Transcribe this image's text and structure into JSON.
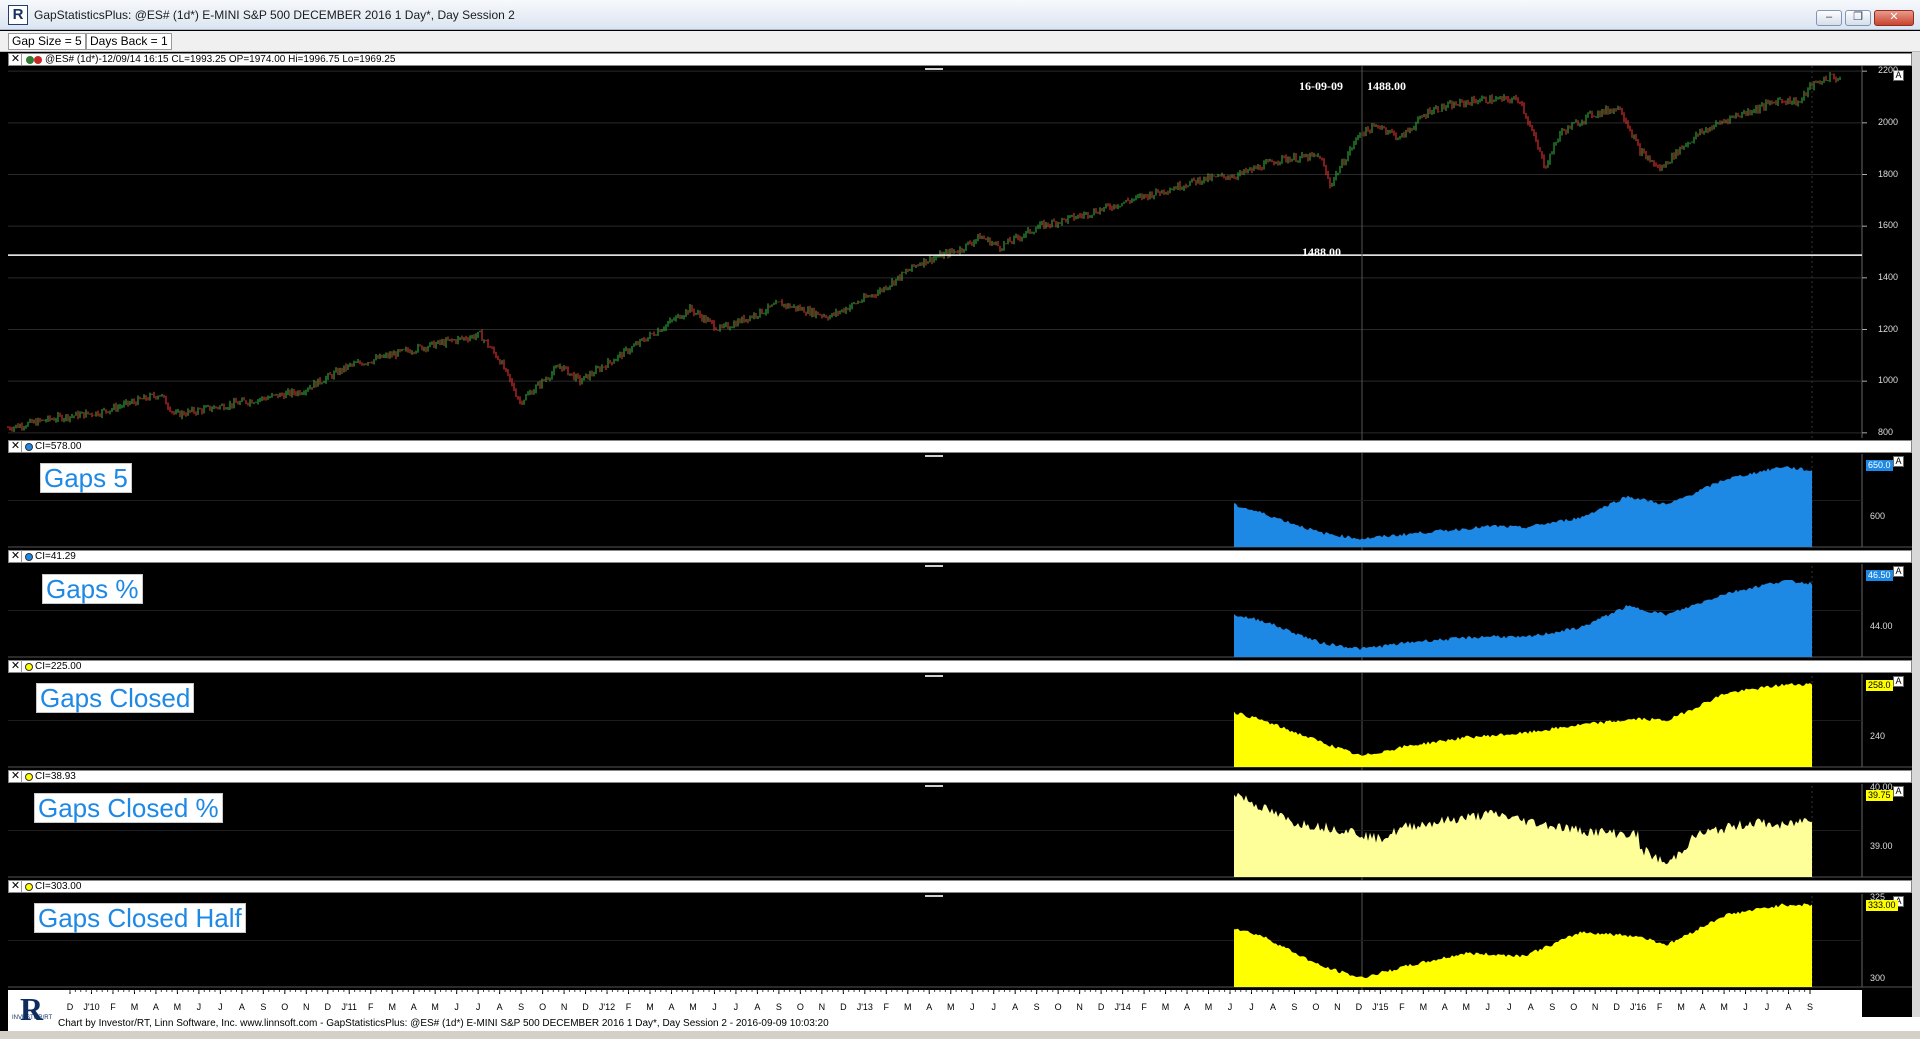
{
  "window": {
    "title": "GapStatisticsPlus: @ES# (1d*) E-MINI S&P 500 DECEMBER 2016 1 Day*, Day Session 2",
    "buttons": {
      "minimize": "–",
      "restore": "❐",
      "close": "✕"
    }
  },
  "params": [
    {
      "label": "Gap Size = 5"
    },
    {
      "label": "Days Back = 1"
    }
  ],
  "price_panel": {
    "header": "@ES# (1d*)-12/09/14 16:15 CL=1993.25 OP=1974.00 Hi=1996.75 Lo=1969.25",
    "cursor_date": "16-09-09",
    "cursor_value": "1488.00",
    "hline_value": "1488.00",
    "y_ticks": [
      "2200",
      "2000",
      "1800",
      "1600",
      "1400",
      "1200",
      "1000",
      "800"
    ],
    "a_label": "A"
  },
  "panels": [
    {
      "header": "CI=578.00",
      "label": "Gaps 5",
      "last": "650.0",
      "tick": "600",
      "dot": "#1e88e5",
      "fill": "#1e88e5"
    },
    {
      "header": "CI=41.29",
      "label": "Gaps %",
      "last": "46.50",
      "tick": "44.00",
      "dot": "#1e88e5",
      "fill": "#1e88e5"
    },
    {
      "header": "CI=225.00",
      "label": "Gaps Closed",
      "last": "258.0",
      "tick": "240",
      "dot": "#ffff00",
      "fill": "#ffff00"
    },
    {
      "header": "CI=38.93",
      "label": "Gaps Closed %",
      "last": "39.75",
      "tick_top": "40.00",
      "tick": "39.00",
      "dot": "#ffff00",
      "fill": "#ffff99"
    },
    {
      "header": "CI=303.00",
      "label": "Gaps Closed Half",
      "last": "333.00",
      "tick_top": "325",
      "tick": "300",
      "dot": "#ffff00",
      "fill": "#ffff00"
    }
  ],
  "time_axis": [
    "D",
    "J'10",
    "F",
    "M",
    "A",
    "M",
    "J",
    "J",
    "A",
    "S",
    "O",
    "N",
    "D",
    "J'11",
    "F",
    "M",
    "A",
    "M",
    "J",
    "J",
    "A",
    "S",
    "O",
    "N",
    "D",
    "J'12",
    "F",
    "M",
    "A",
    "M",
    "J",
    "J",
    "A",
    "S",
    "O",
    "N",
    "D",
    "J'13",
    "F",
    "M",
    "A",
    "M",
    "J",
    "J",
    "A",
    "S",
    "O",
    "N",
    "D",
    "J'14",
    "F",
    "M",
    "A",
    "M",
    "J",
    "J",
    "A",
    "S",
    "O",
    "N",
    "D",
    "J'15",
    "F",
    "M",
    "A",
    "M",
    "J",
    "J",
    "A",
    "S",
    "O",
    "N",
    "D",
    "J'16",
    "F",
    "M",
    "A",
    "M",
    "J",
    "J",
    "A",
    "S"
  ],
  "footer": "Chart by Investor/RT, Linn Software, Inc. www.linnsoft.com - GapStatisticsPlus: @ES# (1d*) E-MINI S&P 500 DECEMBER 2016 1 Day*, Day Session 2 - 2016-09-09 10:03:20",
  "logo_letter": "R",
  "logo_caption": "INVESTOR/RT"
}
